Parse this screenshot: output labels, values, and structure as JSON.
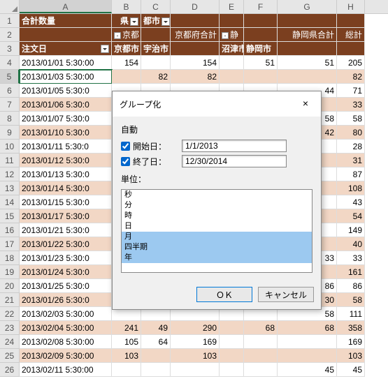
{
  "cols": {
    "A": "A",
    "B": "B",
    "C": "C",
    "D": "D",
    "E": "E",
    "F": "F",
    "G": "G",
    "H": "H"
  },
  "header1": {
    "qty": "合計数量",
    "pref": "県",
    "city": "都市"
  },
  "header2": {
    "kyo": "京都",
    "kyogokei": "京都府合計",
    "shizu": "静",
    "shizugokei": "静岡県合計",
    "sokei": "総計"
  },
  "header3": {
    "order": "注文日",
    "kyoto": "京都市",
    "uji": "宇治市",
    "numazu": "沼津市",
    "shizuoka": "静岡市"
  },
  "rows": [
    {
      "n": "4",
      "d": "2013/01/01 5:30:00",
      "b": "154",
      "c": "",
      "dv": "154",
      "f": "51",
      "g": "51",
      "h": "205",
      "band": 0
    },
    {
      "n": "5",
      "d": "2013/01/03 5:30:00",
      "b": "",
      "c": "82",
      "dv": "82",
      "f": "",
      "g": "",
      "h": "82",
      "band": 1,
      "sel": true
    },
    {
      "n": "6",
      "d": "2013/01/05 5:30:0",
      "b": "",
      "c": "",
      "dv": "",
      "f": "",
      "g": "44",
      "h": "71",
      "band": 0
    },
    {
      "n": "7",
      "d": "2013/01/06 5:30:0",
      "b": "",
      "c": "",
      "dv": "",
      "f": "",
      "g": "",
      "h": "33",
      "band": 1
    },
    {
      "n": "8",
      "d": "2013/01/07 5:30:0",
      "b": "",
      "c": "",
      "dv": "",
      "f": "",
      "g": "58",
      "h": "58",
      "band": 0
    },
    {
      "n": "9",
      "d": "2013/01/10 5:30:0",
      "b": "",
      "c": "",
      "dv": "",
      "f": "",
      "g": "42",
      "h": "80",
      "band": 1
    },
    {
      "n": "10",
      "d": "2013/01/11 5:30:0",
      "b": "",
      "c": "",
      "dv": "",
      "f": "",
      "g": "",
      "h": "28",
      "band": 0
    },
    {
      "n": "11",
      "d": "2013/01/12 5:30:0",
      "b": "",
      "c": "",
      "dv": "",
      "f": "",
      "g": "",
      "h": "31",
      "band": 1
    },
    {
      "n": "12",
      "d": "2013/01/13 5:30:0",
      "b": "",
      "c": "",
      "dv": "",
      "f": "",
      "g": "",
      "h": "87",
      "band": 0
    },
    {
      "n": "13",
      "d": "2013/01/14 5:30:0",
      "b": "",
      "c": "",
      "dv": "",
      "f": "",
      "g": "",
      "h": "108",
      "band": 1
    },
    {
      "n": "14",
      "d": "2013/01/15 5:30:0",
      "b": "",
      "c": "",
      "dv": "",
      "f": "",
      "g": "",
      "h": "43",
      "band": 0
    },
    {
      "n": "15",
      "d": "2013/01/17 5:30:0",
      "b": "",
      "c": "",
      "dv": "",
      "f": "",
      "g": "",
      "h": "54",
      "band": 1
    },
    {
      "n": "16",
      "d": "2013/01/21 5:30:0",
      "b": "",
      "c": "",
      "dv": "",
      "f": "",
      "g": "",
      "h": "149",
      "band": 0
    },
    {
      "n": "17",
      "d": "2013/01/22 5:30:0",
      "b": "",
      "c": "",
      "dv": "",
      "f": "",
      "g": "",
      "h": "40",
      "band": 1
    },
    {
      "n": "18",
      "d": "2013/01/23 5:30:0",
      "b": "",
      "c": "",
      "dv": "",
      "f": "",
      "g": "33",
      "h": "33",
      "band": 0
    },
    {
      "n": "19",
      "d": "2013/01/24 5:30:0",
      "b": "",
      "c": "",
      "dv": "",
      "f": "",
      "g": "",
      "h": "161",
      "band": 1
    },
    {
      "n": "20",
      "d": "2013/01/25 5:30:0",
      "b": "",
      "c": "",
      "dv": "",
      "f": "",
      "g": "86",
      "h": "86",
      "band": 0
    },
    {
      "n": "21",
      "d": "2013/01/26 5:30:0",
      "b": "",
      "c": "",
      "dv": "",
      "f": "",
      "g": "30",
      "h": "58",
      "band": 1
    },
    {
      "n": "22",
      "d": "2013/02/03 5:30:00",
      "b": "",
      "c": "",
      "dv": "",
      "f": "",
      "g": "58",
      "h": "111",
      "band": 0
    },
    {
      "n": "23",
      "d": "2013/02/04 5:30:00",
      "b": "241",
      "c": "49",
      "dv": "290",
      "f": "68",
      "g": "68",
      "h": "358",
      "band": 1
    },
    {
      "n": "24",
      "d": "2013/02/08 5:30:00",
      "b": "105",
      "c": "64",
      "dv": "169",
      "f": "",
      "g": "",
      "h": "169",
      "band": 0
    },
    {
      "n": "25",
      "d": "2013/02/09 5:30:00",
      "b": "103",
      "c": "",
      "dv": "103",
      "f": "",
      "g": "",
      "h": "103",
      "band": 1
    },
    {
      "n": "26",
      "d": "2013/02/11 5:30:00",
      "b": "",
      "c": "",
      "dv": "",
      "f": "",
      "g": "45",
      "h": "45",
      "band": 0
    }
  ],
  "dialog": {
    "title": "グループ化",
    "auto": "自動",
    "start": "開始日：",
    "startv": "1/1/2013",
    "end": "終了日：",
    "endv": "12/30/2014",
    "unit": "単位：",
    "units": [
      "秒",
      "分",
      "時",
      "日",
      "月",
      "四半期",
      "年"
    ],
    "selected": [
      4,
      5,
      6
    ],
    "ok": "ＯＫ",
    "cancel": "キャンセル"
  }
}
